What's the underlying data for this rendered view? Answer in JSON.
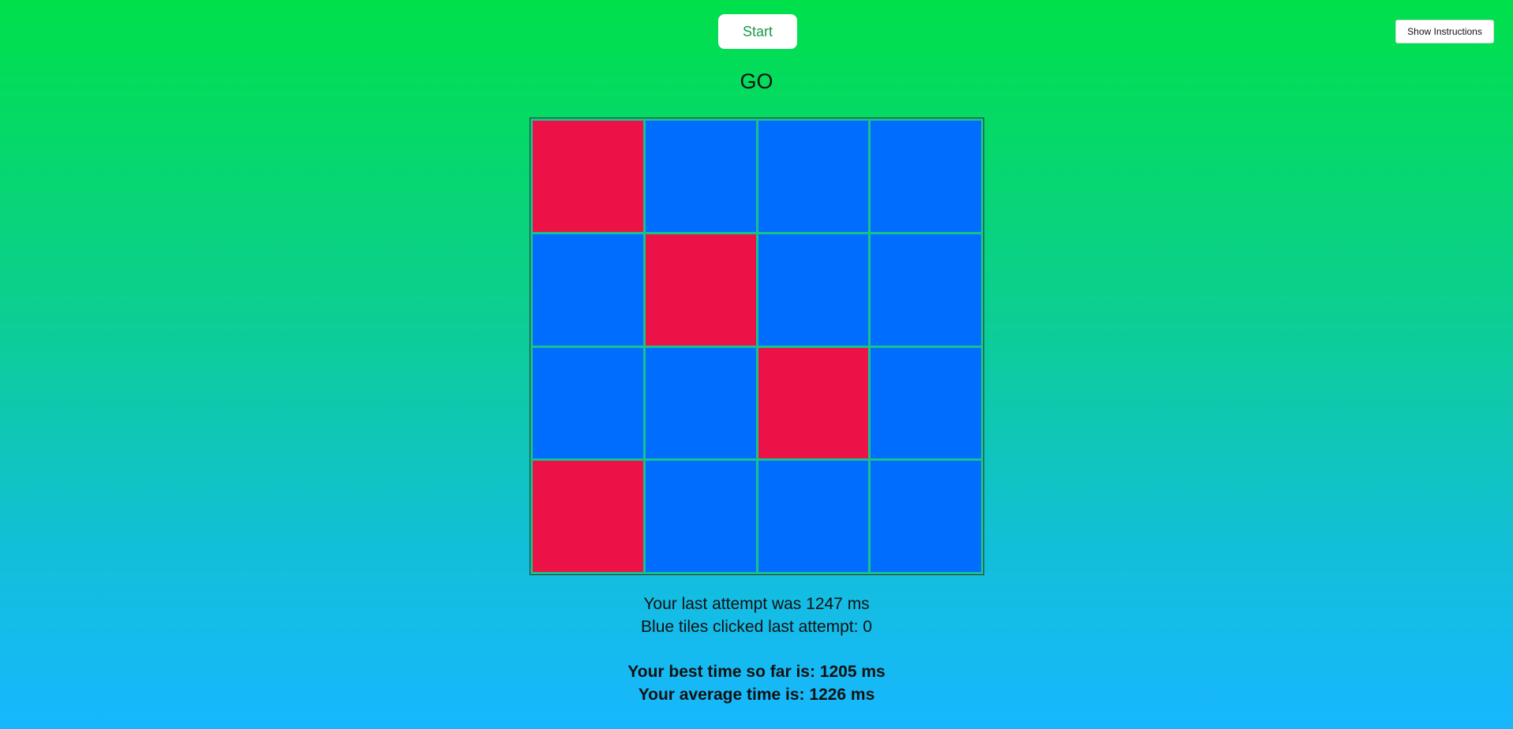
{
  "controls": {
    "start_label": "Start",
    "instructions_label": "Show Instructions"
  },
  "status_text": "GO",
  "grid": {
    "rows": 4,
    "cols": 4,
    "tiles": [
      [
        "red",
        "blue",
        "blue",
        "blue"
      ],
      [
        "blue",
        "red",
        "blue",
        "blue"
      ],
      [
        "blue",
        "blue",
        "red",
        "blue"
      ],
      [
        "red",
        "blue",
        "blue",
        "blue"
      ]
    ],
    "colors": {
      "blue": "#006dff",
      "red": "#ec1247"
    }
  },
  "stats": {
    "last_attempt": "Your last attempt was 1247 ms",
    "blue_clicked": "Blue tiles clicked last attempt: 0",
    "best_time": "Your best time so far is: 1205 ms",
    "average_time": "Your average time is: 1226 ms"
  }
}
